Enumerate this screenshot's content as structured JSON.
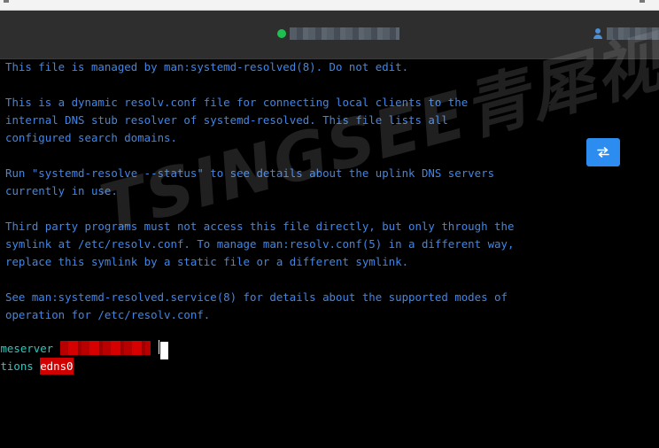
{
  "theme": {
    "terminal_background": "#000000",
    "comment_color": "#3f86e8",
    "keyword_color": "#2ec7bd",
    "highlight_background": "#d00000",
    "status_online_color": "#1ec04f",
    "button_color": "#2d8cf0"
  },
  "header": {
    "connection_status": "online",
    "host_label_redacted": true,
    "user_label_redacted": true,
    "status_icon": "status-dot-icon",
    "user_icon": "user-icon"
  },
  "terminal": {
    "lines": [
      "This file is managed by man:systemd-resolved(8). Do not edit.",
      "",
      "This is a dynamic resolv.conf file for connecting local clients to the",
      "internal DNS stub resolver of systemd-resolved. This file lists all",
      "configured search domains.",
      "",
      "Run \"systemd-resolve --status\" to see details about the uplink DNS servers",
      "currently in use.",
      "",
      "Third party programs must not access this file directly, but only through the",
      "symlink at /etc/resolv.conf. To manage man:resolv.conf(5) in a different way,",
      "replace this symlink by a static file or a different symlink.",
      "",
      "See man:systemd-resolved.service(8) for details about the supported modes of",
      "operation for /etc/resolv.conf.",
      ""
    ],
    "nameserver_keyword": "ameserver ",
    "nameserver_value_redacted": true,
    "options_keyword": "ptions ",
    "options_value": "edns0"
  },
  "side_button": {
    "icon": "swap-arrows-icon"
  },
  "watermark": {
    "text": "TSINGSEE青犀视频"
  }
}
